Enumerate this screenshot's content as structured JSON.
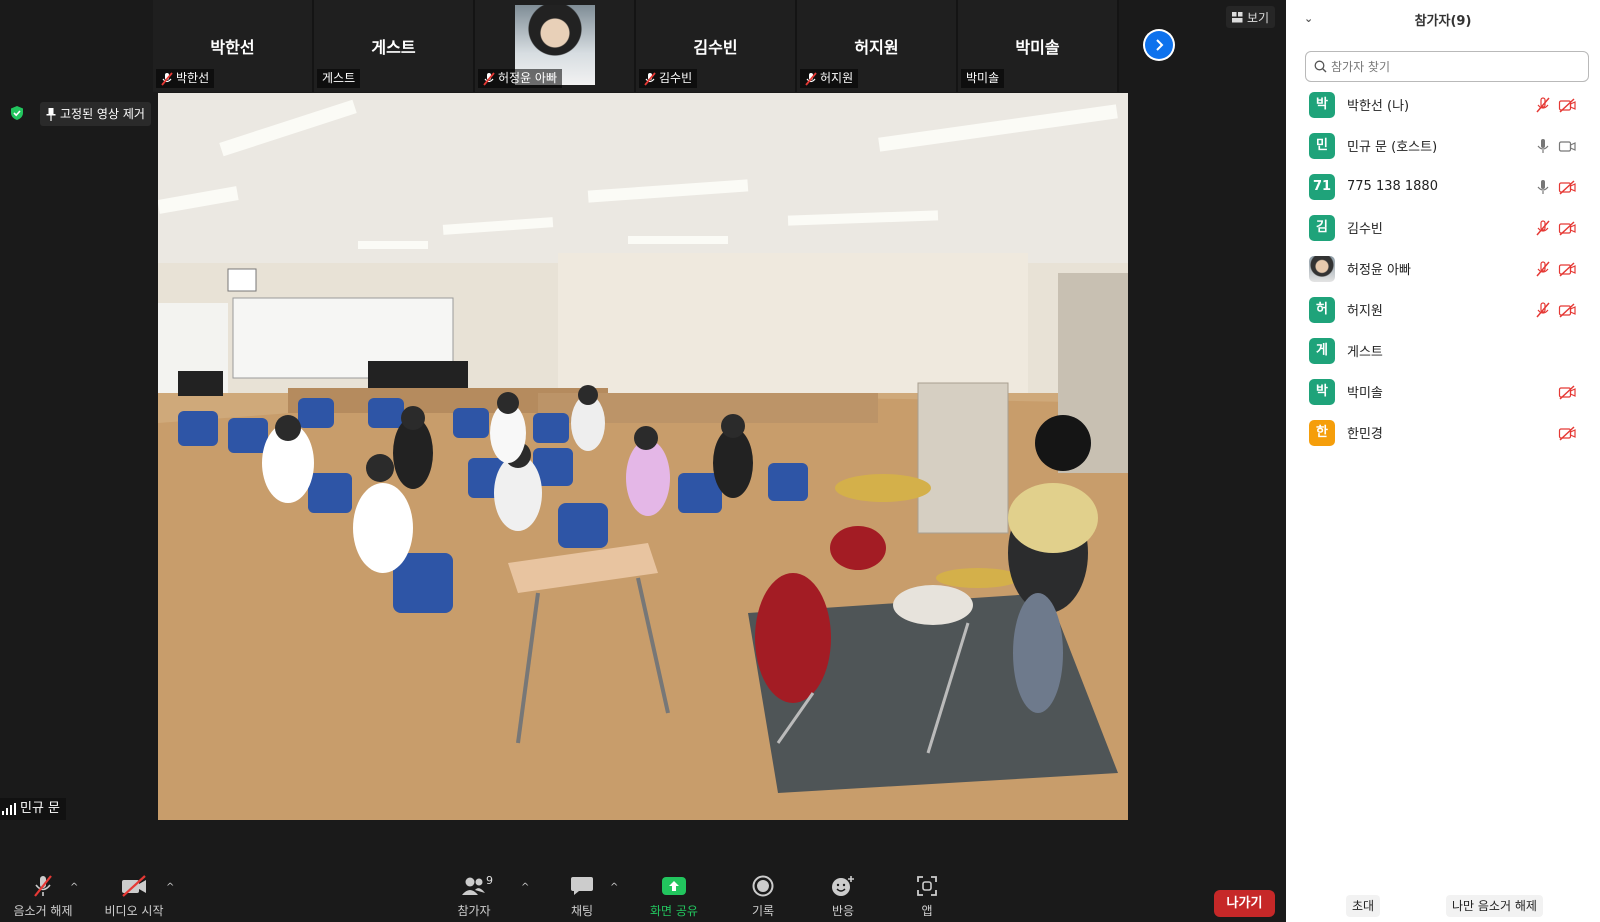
{
  "strip": {
    "tiles": [
      {
        "big": "박한선",
        "tag": "박한선",
        "muted": true
      },
      {
        "big": "게스트",
        "tag": "게스트",
        "muted": false
      },
      {
        "big": "",
        "tag": "허정윤 아빠",
        "muted": true,
        "photo": true
      },
      {
        "big": "김수빈",
        "tag": "김수빈",
        "muted": true
      },
      {
        "big": "허지원",
        "tag": "허지원",
        "muted": true
      },
      {
        "big": "박미솔",
        "tag": "박미솔",
        "muted": false
      }
    ]
  },
  "view_label": "보기",
  "unpin_label": "고정된 영상 제거",
  "speaker_name": "민규 문",
  "toolbar": {
    "unmute": "음소거 해제",
    "start_video": "비디오 시작",
    "participants": "참가자",
    "participants_count": "9",
    "chat": "채팅",
    "share": "화면 공유",
    "record": "기록",
    "reactions": "반응",
    "apps": "앱",
    "leave": "나가기"
  },
  "panel": {
    "title": "참가자(9)",
    "search_placeholder": "참가자 찾기",
    "invite": "초대",
    "unmute_me": "나만 음소거 해제",
    "participants": [
      {
        "initial": "박",
        "name": "박한선 (나)",
        "color": "#1fa37a",
        "mic": "off",
        "video": "off"
      },
      {
        "initial": "민",
        "name": "민규 문 (호스트)",
        "color": "#1fa37a",
        "mic": "on",
        "video": "on"
      },
      {
        "initial": "71",
        "name": "775 138 1880",
        "color": "#1fa37a",
        "mic": "on",
        "video": "off"
      },
      {
        "initial": "김",
        "name": "김수빈",
        "color": "#1fa37a",
        "mic": "off",
        "video": "off"
      },
      {
        "initial": "",
        "name": "허정윤 아빠",
        "color": "",
        "photo": true,
        "mic": "off",
        "video": "off"
      },
      {
        "initial": "허",
        "name": "허지원",
        "color": "#1fa37a",
        "mic": "off",
        "video": "off"
      },
      {
        "initial": "게",
        "name": "게스트",
        "color": "#1fa37a",
        "mic": "none",
        "video": "none"
      },
      {
        "initial": "박",
        "name": "박미솔",
        "color": "#1fa37a",
        "mic": "none",
        "video": "off"
      },
      {
        "initial": "한",
        "name": "한민경",
        "color": "#f59e0b",
        "mic": "none",
        "video": "off"
      }
    ]
  }
}
